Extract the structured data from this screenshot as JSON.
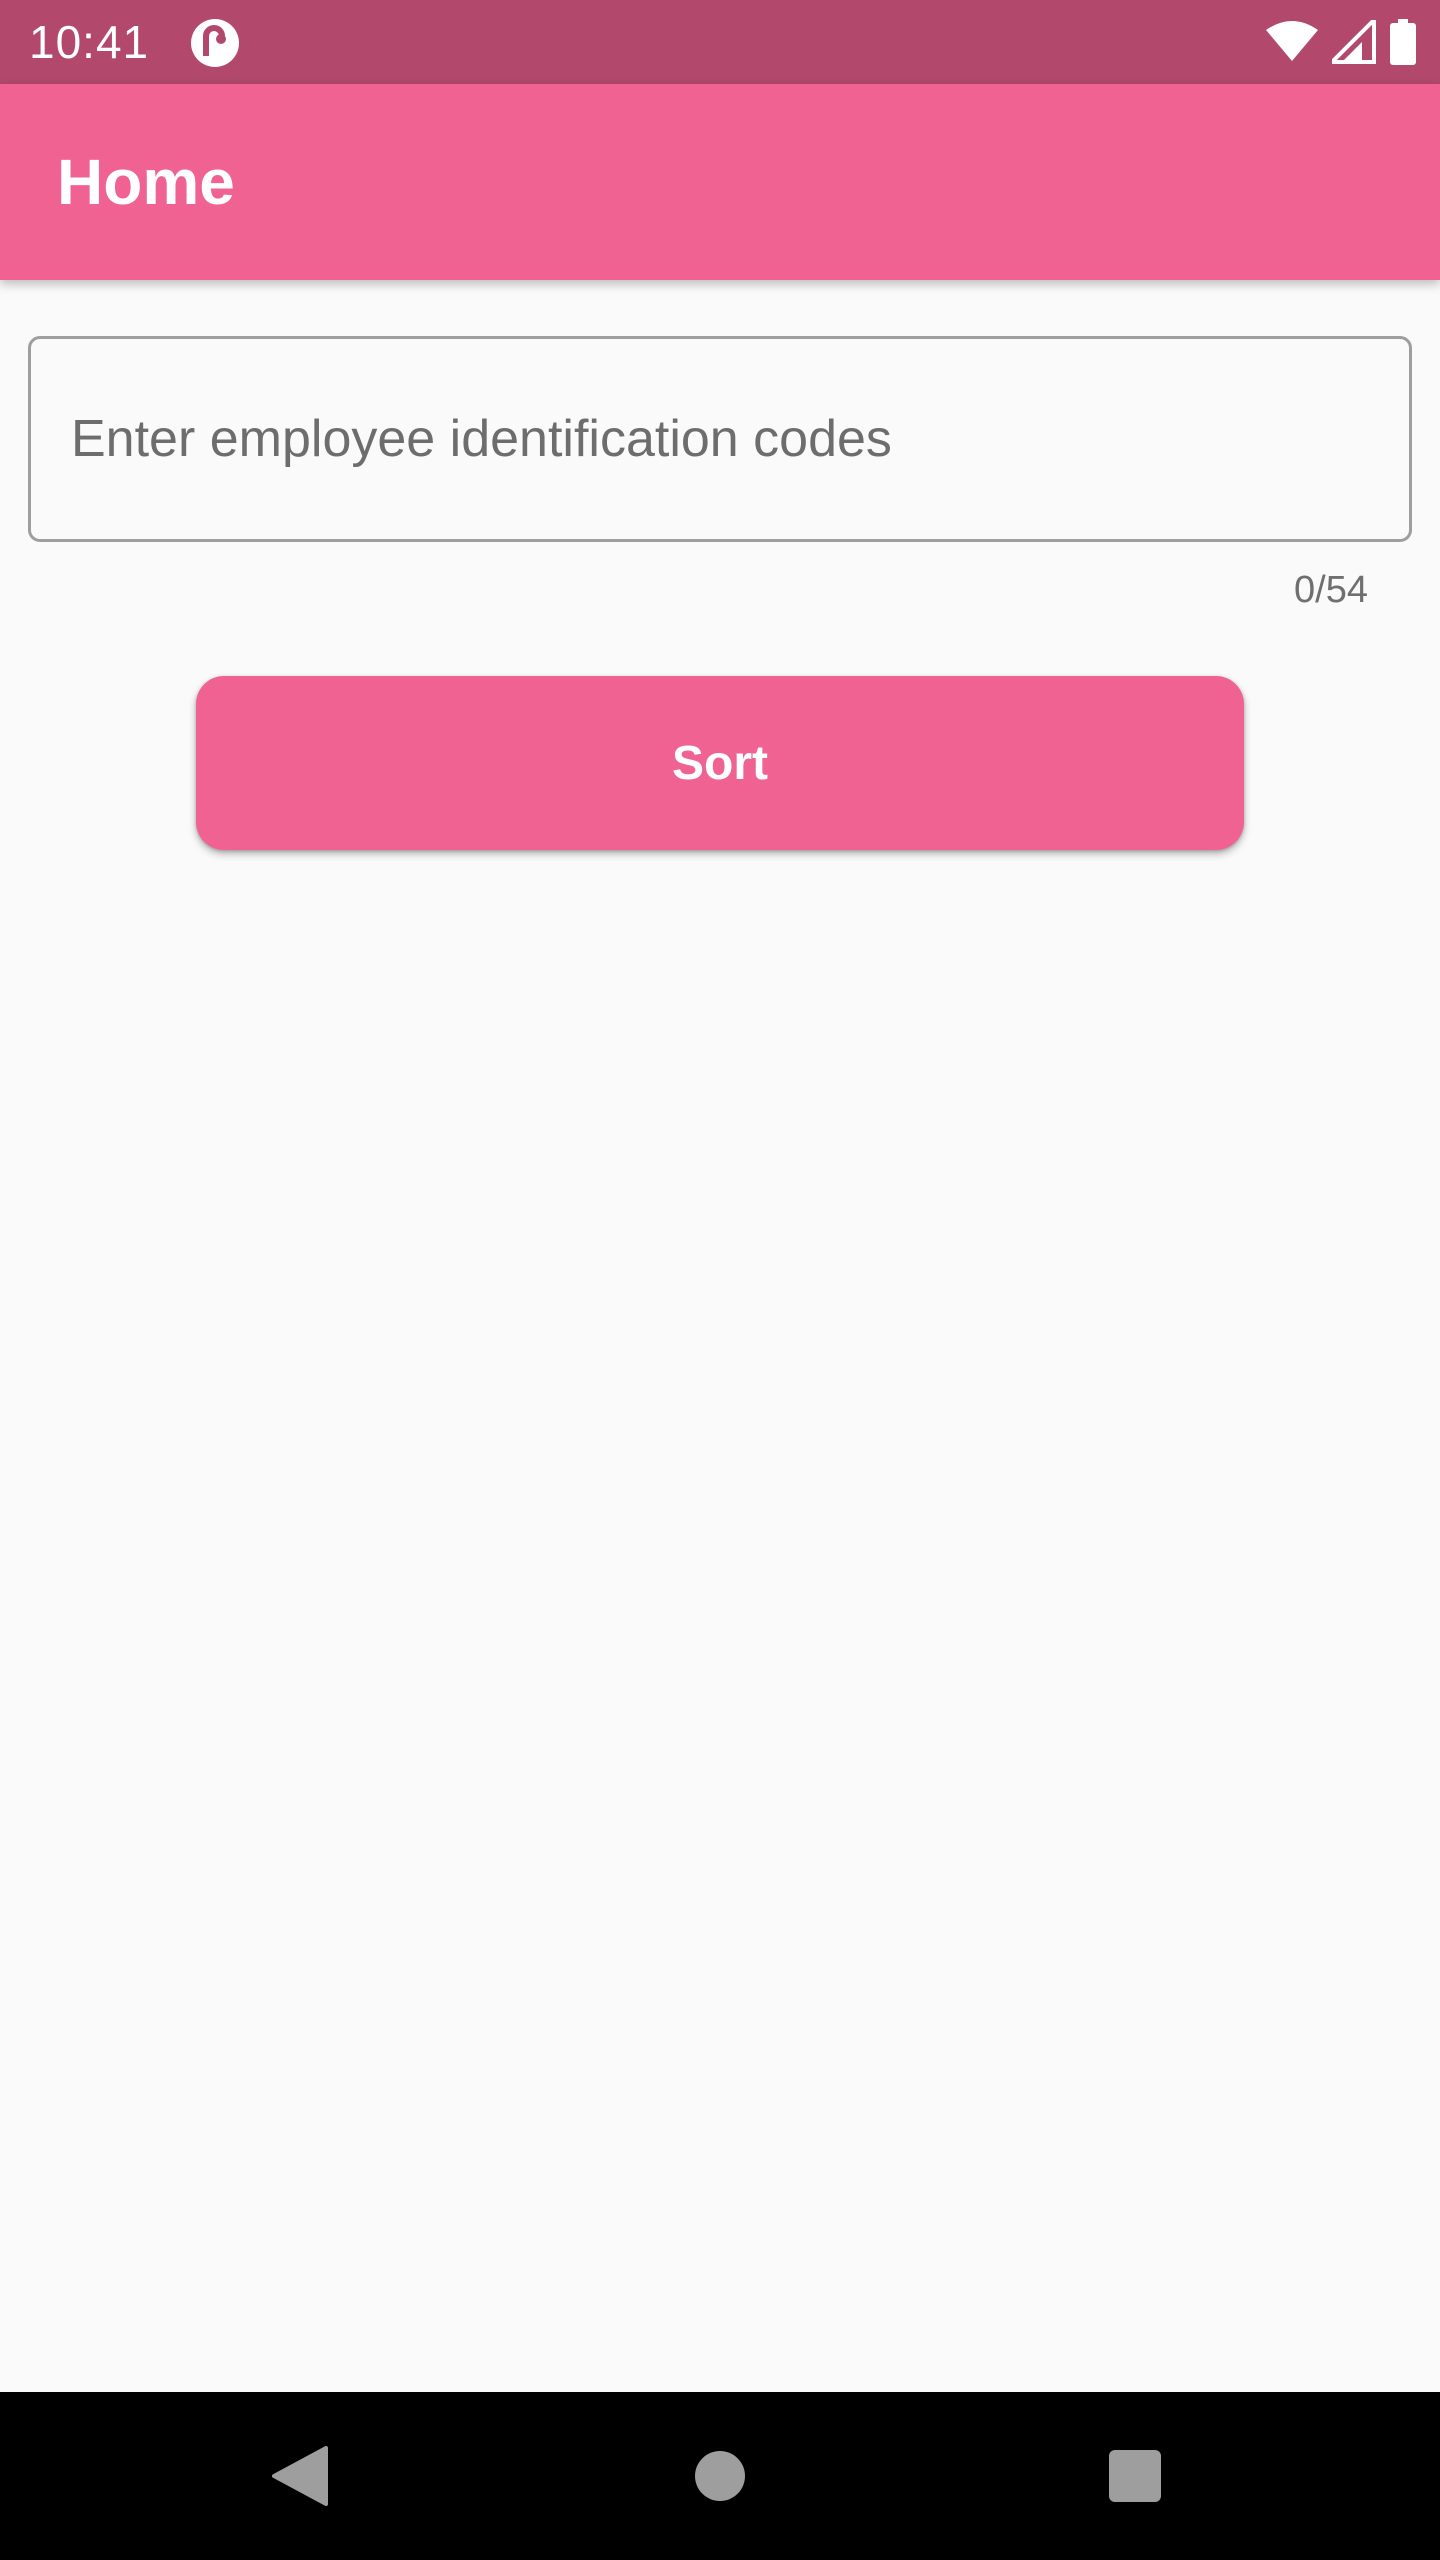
{
  "status_bar": {
    "time": "10:41",
    "app_icon": "notification-app-icon",
    "icons": [
      "wifi-icon",
      "signal-icon",
      "battery-icon"
    ],
    "color": "#b2496c"
  },
  "app_bar": {
    "title": "Home",
    "color": "#f06292"
  },
  "form": {
    "input": {
      "placeholder": "Enter employee identification codes",
      "value": ""
    },
    "counter": "0/54",
    "sort_label": "Sort"
  },
  "nav_bar": {
    "icons": [
      "back-icon",
      "home-icon",
      "recents-icon"
    ]
  }
}
